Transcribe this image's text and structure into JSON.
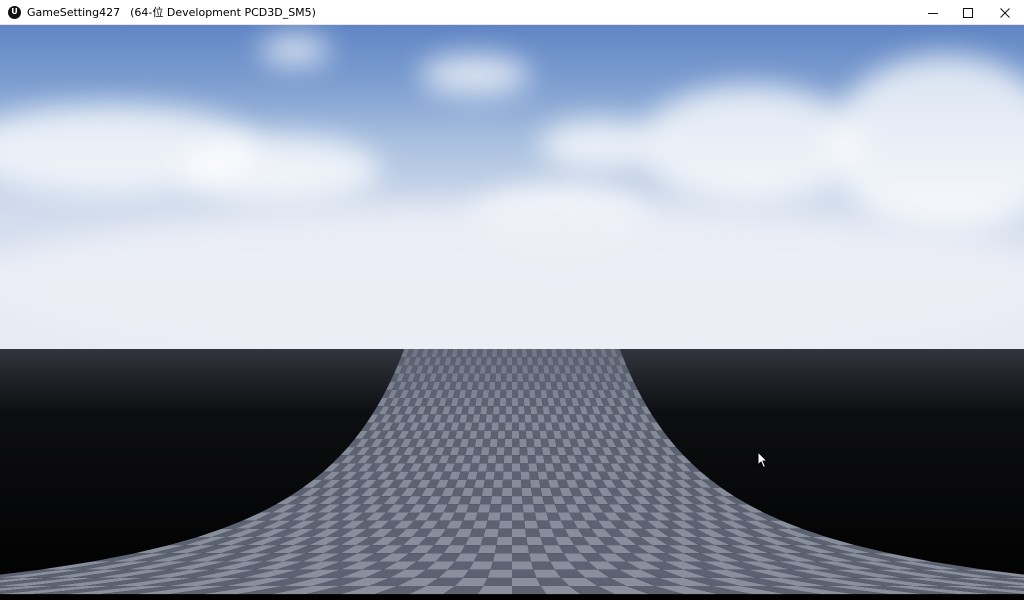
{
  "window": {
    "title": "GameSetting427",
    "subtitle": "(64-位 Development PCD3D_SM5)",
    "app_icon": "unreal-engine-icon",
    "controls": {
      "minimize": "minimize-icon",
      "maximize": "maximize-icon",
      "close": "close-icon"
    }
  },
  "scene": {
    "sky_top_color": "#5f85c4",
    "horizon_color": "#e9ebf4",
    "floor_light_color": "#8a909e",
    "floor_dark_color": "#5c6271"
  }
}
